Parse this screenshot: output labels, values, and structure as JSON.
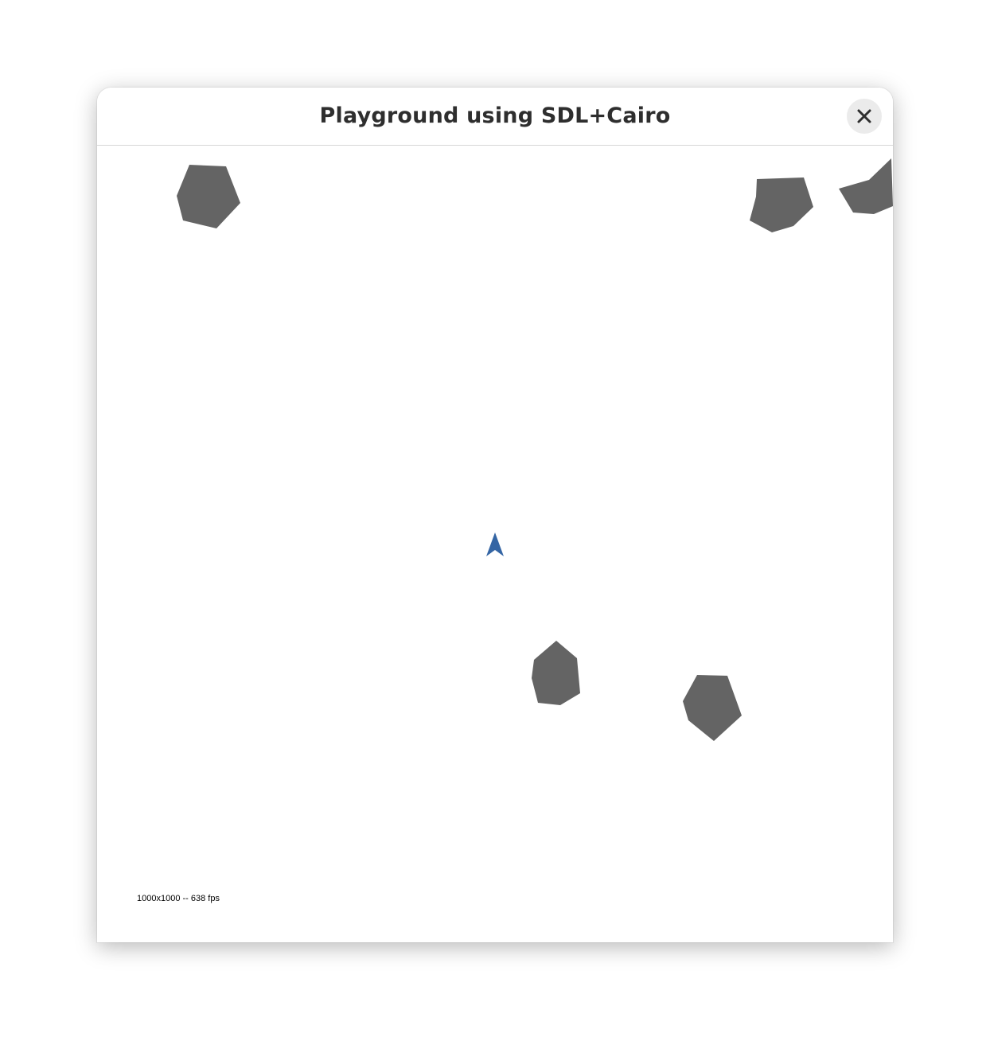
{
  "window": {
    "title": "Playground using SDL+Cairo",
    "close_icon": "close-icon"
  },
  "game": {
    "hud_text": "1000x1000 -- 638 fps",
    "colors": {
      "background": "#ffffff",
      "asteroid": "#646464",
      "ship": "#3465a4"
    }
  }
}
